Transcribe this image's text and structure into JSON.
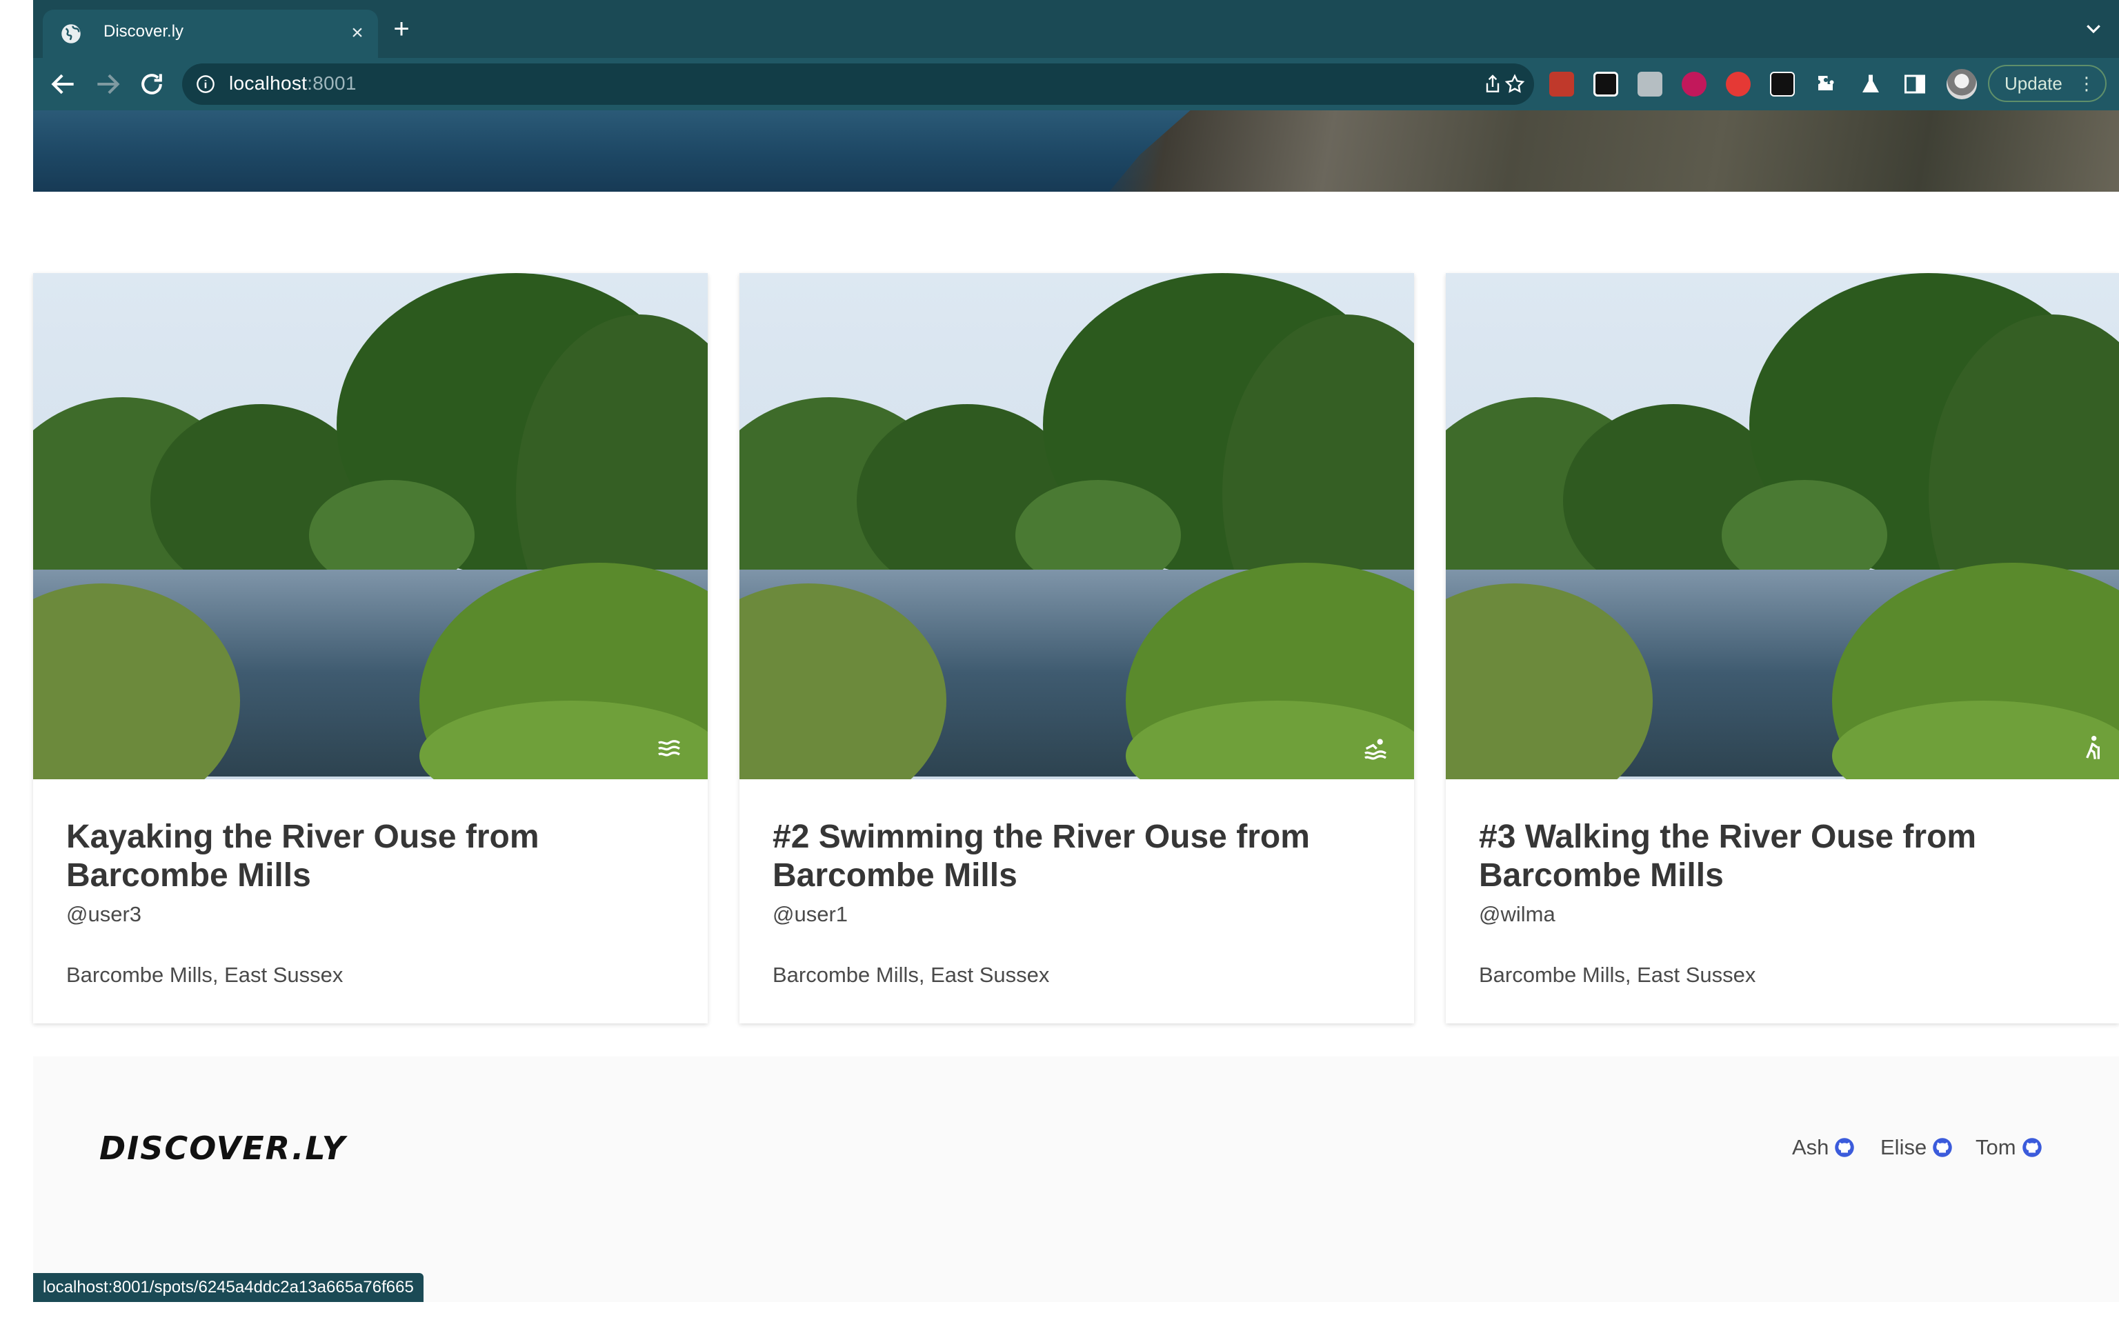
{
  "browser": {
    "tab_title": "Discover.ly",
    "url_host": "localhost",
    "url_port": ":8001",
    "update_label": "Update",
    "update_menu": "⋮"
  },
  "cards": [
    {
      "title": "Kayaking the River Ouse from Barcombe Mills",
      "user": "@user3",
      "location": "Barcombe Mills, East Sussex",
      "activity_icon": "water-waves-icon"
    },
    {
      "title": "#2 Swimming the River Ouse from Barcombe Mills",
      "user": "@user1",
      "location": "Barcombe Mills, East Sussex",
      "activity_icon": "swimmer-icon"
    },
    {
      "title": "#3 Walking the River Ouse from Barcombe Mills",
      "user": "@wilma",
      "location": "Barcombe Mills, East Sussex",
      "activity_icon": "hiker-icon"
    }
  ],
  "footer": {
    "brand": "DISCOVER.LY",
    "team": [
      {
        "name": "Ash"
      },
      {
        "name": "Elise"
      },
      {
        "name": "Tom"
      }
    ]
  },
  "status_bar": {
    "link_url": "localhost:8001/spots/6245a4ddc2a13a665a76f665"
  },
  "colors": {
    "chrome": "#1b4a55",
    "toolbar": "#205865",
    "text": "#363636",
    "link_icon": "#3b5bdb"
  }
}
